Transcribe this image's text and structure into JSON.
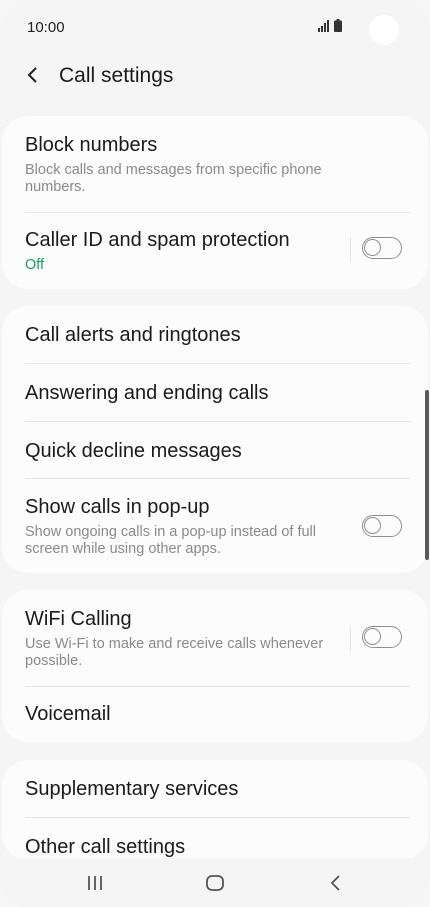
{
  "status_bar": {
    "time": "10:00",
    "icons": [
      "signal-icon",
      "battery-icon"
    ]
  },
  "header": {
    "back_icon": "chevron-left-icon",
    "title": "Call settings"
  },
  "cards": [
    {
      "items": [
        {
          "title": "Block numbers",
          "subtitle": "Block calls and messages from specific phone numbers."
        },
        {
          "title": "Caller ID and spam protection",
          "subtitle": "Off",
          "toggle": false
        }
      ]
    },
    {
      "items": [
        {
          "title": "Call alerts and ringtones"
        },
        {
          "title": "Answering and ending calls"
        },
        {
          "title": "Quick decline messages"
        },
        {
          "title": "Show calls in pop-up",
          "subtitle": "Show ongoing calls in a pop-up instead of full screen while using other apps.",
          "toggle": false
        }
      ]
    },
    {
      "items": [
        {
          "title": "WiFi Calling",
          "subtitle": "Use Wi-Fi to make and receive calls whenever possible.",
          "toggle": false
        },
        {
          "title": "Voicemail"
        }
      ]
    },
    {
      "items": [
        {
          "title": "Supplementary services"
        },
        {
          "title": "Other call settings"
        }
      ]
    }
  ],
  "nav_bar": {
    "icons": [
      "recent-apps-icon",
      "home-icon",
      "back-icon"
    ]
  },
  "colors": {
    "accent_green": "#1a9e5a",
    "background": "#f5f5f5",
    "card": "#fcfcfc",
    "toggle_off": "#8f8f8f"
  }
}
